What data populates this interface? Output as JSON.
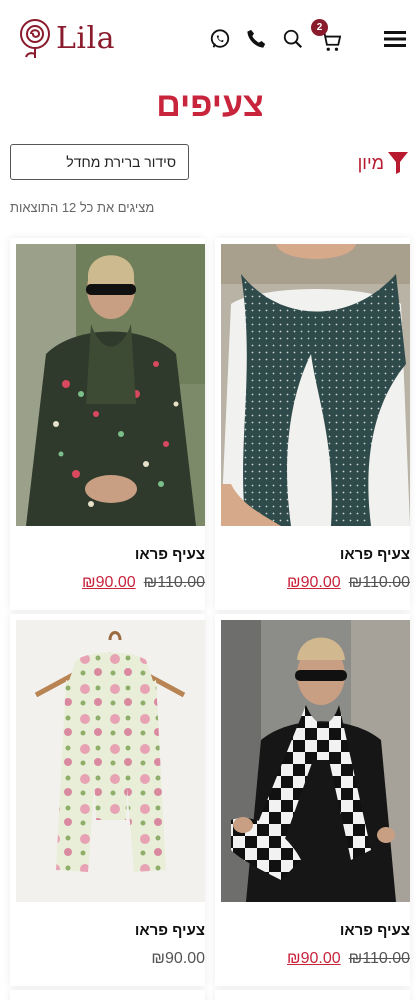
{
  "header": {
    "logo_text": "Lila",
    "cart_count": "2",
    "icons": [
      "menu-icon",
      "cart-icon",
      "search-icon",
      "phone-icon",
      "whatsapp-icon"
    ]
  },
  "page": {
    "title": "צעיפים"
  },
  "toolbar": {
    "filter_label": "מיון",
    "sort_value": "סידור ברירת מחדל",
    "results_text": "מציגים את כל 12 התוצאות"
  },
  "products": [
    {
      "name": "צעיף פראו",
      "old_price": "₪110.00",
      "price": "₪90.00",
      "on_sale": true
    },
    {
      "name": "צעיף פראו",
      "old_price": "₪110.00",
      "price": "₪90.00",
      "on_sale": true
    },
    {
      "name": "צעיף פראו",
      "old_price": "₪110.00",
      "price": "₪90.00",
      "on_sale": true
    },
    {
      "name": "צעיף פראו",
      "old_price": "",
      "price": "₪90.00",
      "on_sale": false
    }
  ],
  "colors": {
    "brand": "#8a1b2c",
    "accent": "#c8243c"
  }
}
